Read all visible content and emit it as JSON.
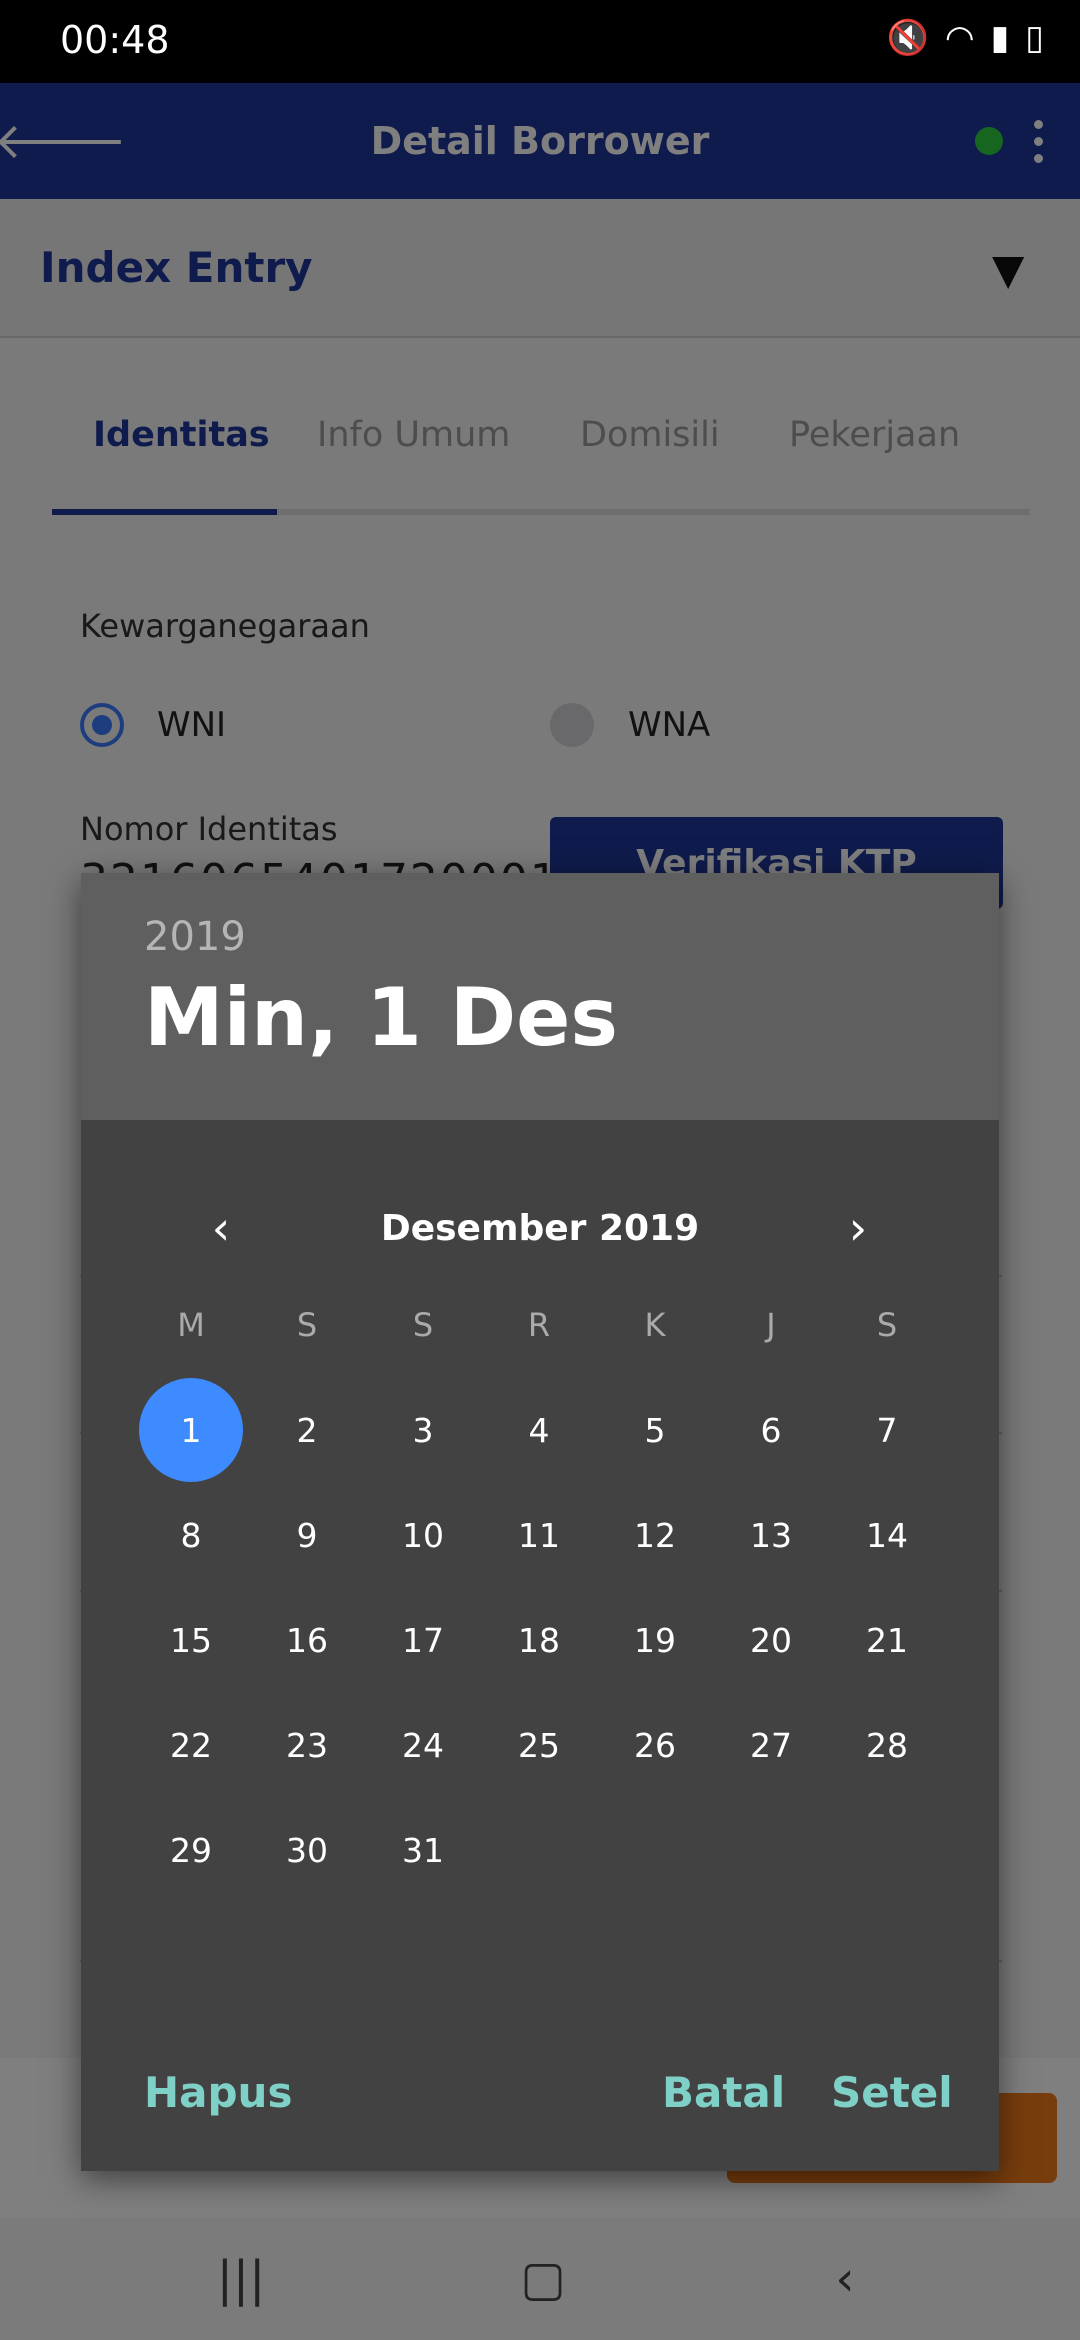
{
  "status": {
    "time": "00:48",
    "icons": [
      "mute-icon",
      "wifi-icon",
      "signal-icon",
      "battery-icon"
    ]
  },
  "appbar": {
    "title": "Detail Borrower",
    "status_color": "#2ecc40"
  },
  "index_entry": {
    "title": "Index Entry"
  },
  "tabs": [
    {
      "label": "Identitas",
      "active": true
    },
    {
      "label": "Info Umum",
      "active": false
    },
    {
      "label": "Domisili",
      "active": false
    },
    {
      "label": "Pekerjaan",
      "active": false
    }
  ],
  "form": {
    "kewarganegaraan_label": "Kewarganegaraan",
    "option_wni": "WNI",
    "option_wna": "WNA",
    "selected": "WNI",
    "nomor_identitas_label": "Nomor Identitas",
    "nomor_identitas_value": "3216065401720001",
    "verify_button": "Verifikasi KTP"
  },
  "datepicker": {
    "year": "2019",
    "selected_date": "Min, 1 Des",
    "month_title": "Desember 2019",
    "weekdays": [
      "M",
      "S",
      "S",
      "R",
      "K",
      "J",
      "S"
    ],
    "weeks": [
      [
        "1",
        "2",
        "3",
        "4",
        "5",
        "6",
        "7"
      ],
      [
        "8",
        "9",
        "10",
        "11",
        "12",
        "13",
        "14"
      ],
      [
        "15",
        "16",
        "17",
        "18",
        "19",
        "20",
        "21"
      ],
      [
        "22",
        "23",
        "24",
        "25",
        "26",
        "27",
        "28"
      ],
      [
        "29",
        "30",
        "31",
        "",
        "",
        "",
        ""
      ]
    ],
    "selected_day": "1",
    "buttons": {
      "clear": "Hapus",
      "cancel": "Batal",
      "set": "Setel"
    },
    "accent_color": "#3d8bff",
    "button_color": "#7fd0c7"
  },
  "colors": {
    "primary": "#1e3799",
    "action_orange": "#f07a1a"
  }
}
